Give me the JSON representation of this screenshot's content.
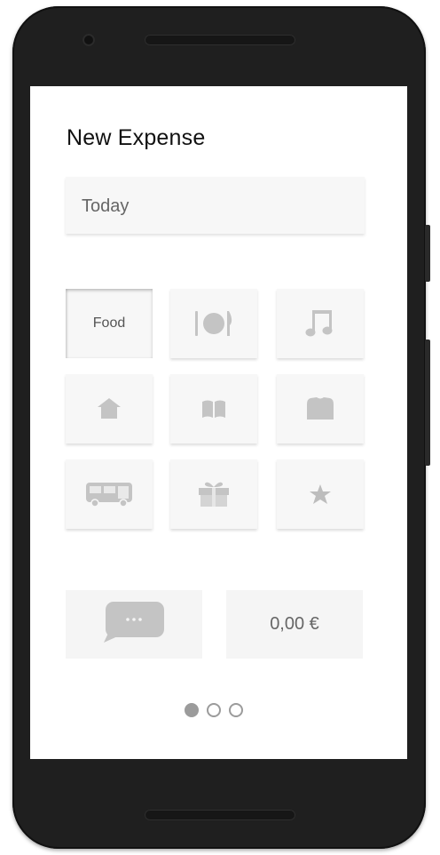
{
  "screen": {
    "title": "New Expense",
    "date_field": {
      "value": "Today"
    },
    "categories": [
      {
        "label": "Food",
        "icon": "food-label",
        "selected": true
      },
      {
        "label": "",
        "icon": "plate-cutlery-icon",
        "selected": false
      },
      {
        "label": "",
        "icon": "music-note-icon",
        "selected": false
      },
      {
        "label": "",
        "icon": "house-icon",
        "selected": false
      },
      {
        "label": "",
        "icon": "book-icon",
        "selected": false
      },
      {
        "label": "",
        "icon": "shirt-icon",
        "selected": false
      },
      {
        "label": "",
        "icon": "bus-icon",
        "selected": false
      },
      {
        "label": "",
        "icon": "gift-icon",
        "selected": false
      },
      {
        "label": "",
        "icon": "star-icon",
        "selected": false
      }
    ],
    "comment_button": {
      "icon": "speech-bubble-icon",
      "text": "···"
    },
    "amount_button": {
      "value": "0,00 €"
    },
    "pager": {
      "pages": 3,
      "active": 1
    }
  },
  "colors": {
    "icon_gray": "#c4c4c4",
    "tile_bg": "#f7f7f7",
    "phone_body": "#1f1f1f",
    "dot_gray": "#9b9b9b"
  }
}
